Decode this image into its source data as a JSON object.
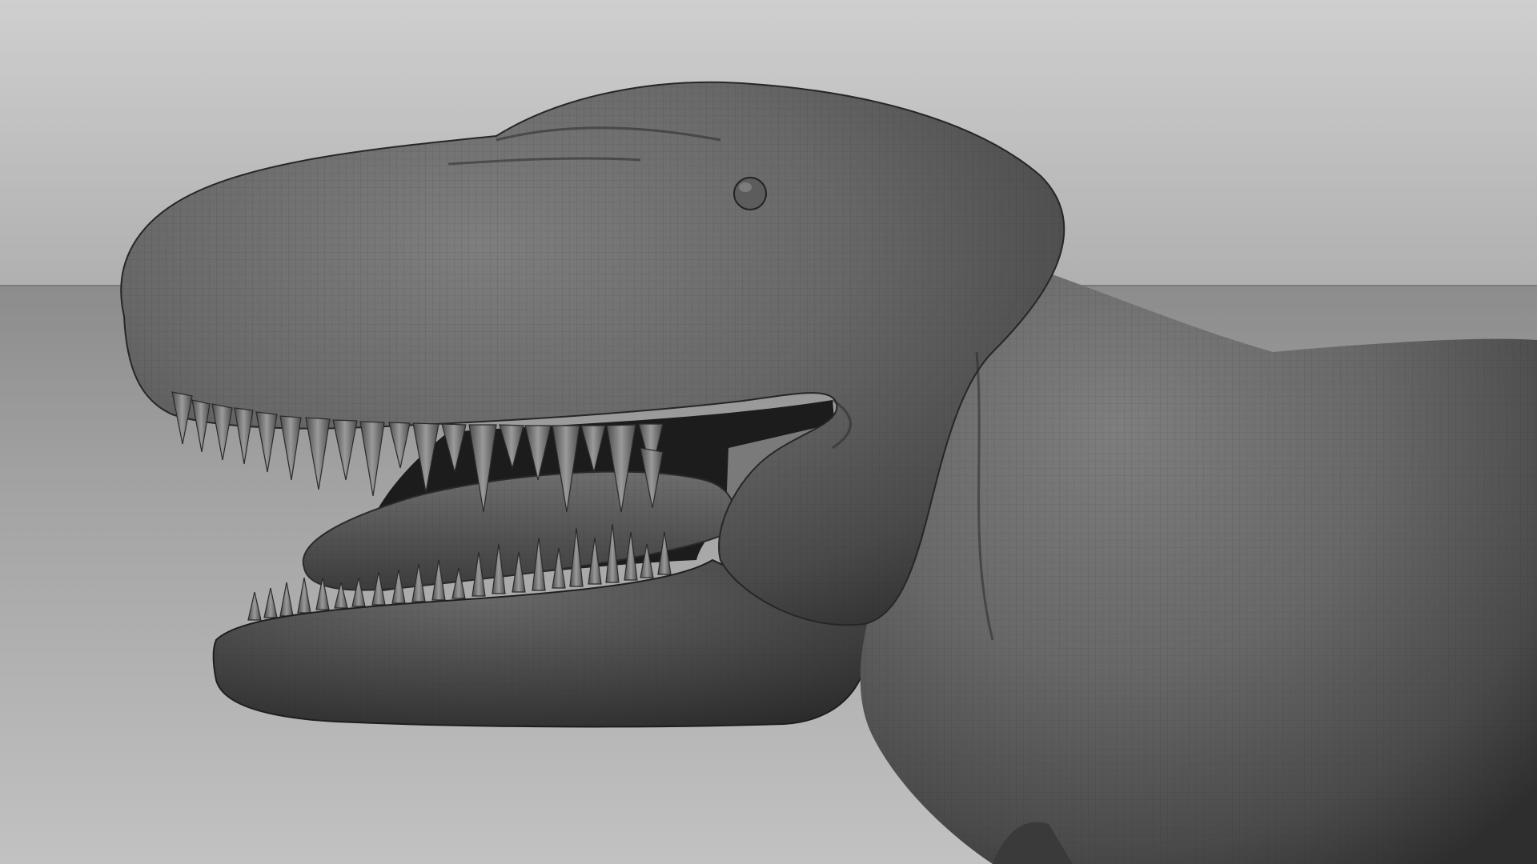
{
  "viewport": {
    "shading_mode": "wireframe-on-shaded",
    "subject_icon": "dinosaur-head-icon"
  },
  "colors": {
    "backdrop_top": "#c9c9c9",
    "backdrop_mid": "#9c9c9c",
    "backdrop_floor": "#a8a8a8",
    "horizon_line": "#6e6e6e",
    "model_light": "#7a7a7a",
    "model_dark": "#2f2f2f",
    "teeth": "#8a8a8a",
    "mouth_interior": "#1f1f1f",
    "wire_grid": "#2a2a2a"
  }
}
